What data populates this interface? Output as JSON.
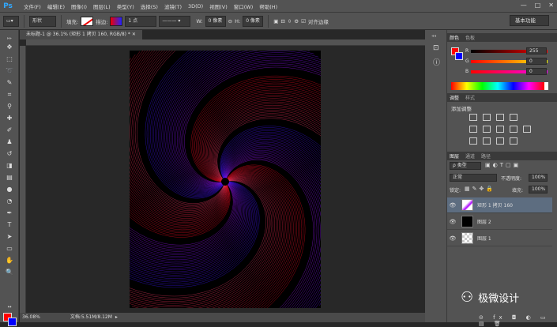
{
  "app": {
    "logo": "Ps"
  },
  "menu": [
    "文件(F)",
    "编辑(E)",
    "图像(I)",
    "图层(L)",
    "类型(Y)",
    "选择(S)",
    "滤镜(T)",
    "3D(D)",
    "视图(V)",
    "窗口(W)",
    "帮助(H)"
  ],
  "window_controls": {
    "minimize": "—",
    "maximize": "□",
    "close": "✕"
  },
  "options": {
    "shape_mode": "形状",
    "fill_label": "填充:",
    "stroke_label": "描边:",
    "stroke_width": "1 点",
    "w_label": "W:",
    "w_value": "0 像素",
    "h_label": "H:",
    "h_value": "0 像素",
    "align_edges_label": "对齐边缘",
    "workspace": "基本功能"
  },
  "document": {
    "tab_title": "未标题-1 @ 36.1% (矩形 1 拷贝 160, RGB/8) *",
    "zoom": "36.08%",
    "doc_info": "文档:5.51M/8.12M"
  },
  "color_panel": {
    "tabs": [
      "颜色",
      "色板"
    ],
    "r_label": "R",
    "g_label": "G",
    "b_label": "B",
    "r_value": "255",
    "g_value": "0",
    "b_value": "0",
    "accent_fg": "#ff0000",
    "accent_bg": "#0000ff"
  },
  "adjustments_panel": {
    "tabs": [
      "调整",
      "样式"
    ],
    "title": "添加调整"
  },
  "layers_panel": {
    "tabs": [
      "图层",
      "通道",
      "路径"
    ],
    "filter_kind": "ρ 类型",
    "blend_mode": "正常",
    "opacity_label": "不透明度:",
    "opacity_value": "100%",
    "lock_label": "锁定:",
    "fill_label": "填充:",
    "fill_value": "100%",
    "layers": [
      {
        "name": "矩形 1 拷贝 160",
        "selected": true
      },
      {
        "name": "图层 2",
        "selected": false
      },
      {
        "name": "图层 1",
        "selected": false
      }
    ]
  },
  "watermark": {
    "text": "极微设计"
  }
}
